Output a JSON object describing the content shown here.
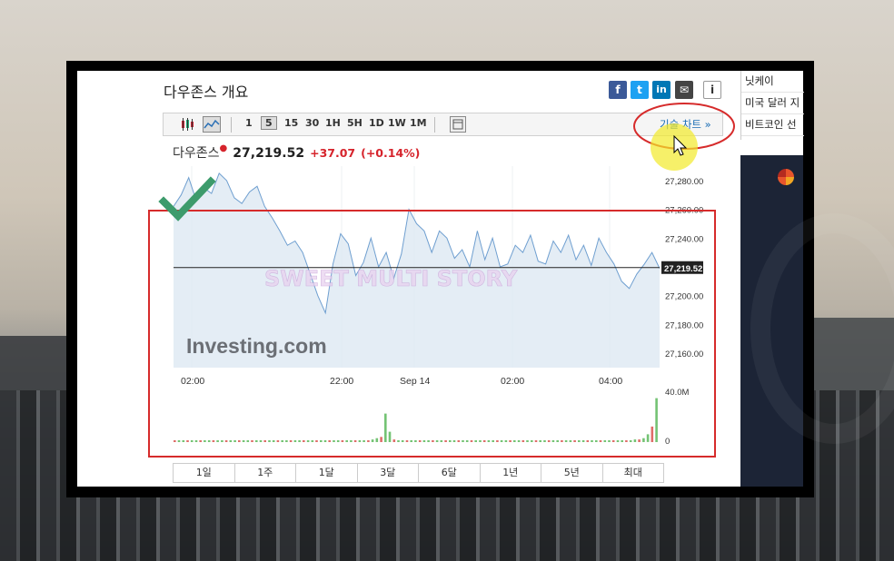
{
  "page": {
    "title": "다우존스 개요"
  },
  "share": {
    "facebook": "f",
    "twitter": "t",
    "linkedin": "in",
    "mail": "✉",
    "info": "i"
  },
  "toolbar": {
    "intervals": [
      "1",
      "5",
      "15",
      "30",
      "1H",
      "5H",
      "1D",
      "1W",
      "1M"
    ],
    "selected_interval": "5",
    "tech_chart_label": "기술 차트 »"
  },
  "quote": {
    "name": "다우존스",
    "price": "27,219.52",
    "change": "+37.07",
    "change_pct": "(+0.14%)"
  },
  "side_list": [
    "닛케이",
    "미국 달러 지",
    "비트코인 선"
  ],
  "periods": [
    "1일",
    "1주",
    "1달",
    "3달",
    "6달",
    "1년",
    "5년",
    "최대"
  ],
  "watermark": "Investing.com",
  "overlay_text": "SWEET MULTI STORY",
  "colors": {
    "accent": "#1b6eb5",
    "negative": "#d6242c",
    "area_fill": "#dde8f3",
    "area_line": "#6f9fd0",
    "annotation": "#d62b2b",
    "check": "#3d9b6c",
    "cursor_highlight": "#f2ea2a"
  },
  "chart_data": {
    "type": "area",
    "ylim": [
      27150,
      27290
    ],
    "y_ticks": [
      "27,280.00",
      "27,260.00",
      "27,240.00",
      "27,220.00",
      "27,200.00",
      "27,180.00",
      "27,160.00"
    ],
    "y_tick_values": [
      27280,
      27260,
      27240,
      27220,
      27200,
      27180,
      27160
    ],
    "x_ticks": [
      "02:00",
      "22:00",
      "Sep 14",
      "02:00",
      "04:00"
    ],
    "last_value_label": "27,219.52",
    "reference_line": 27219.52,
    "values": [
      27262,
      27270,
      27282,
      27266,
      27275,
      27271,
      27285,
      27280,
      27268,
      27264,
      27272,
      27276,
      27262,
      27254,
      27245,
      27235,
      27238,
      27230,
      27215,
      27200,
      27188,
      27222,
      27243,
      27236,
      27214,
      27223,
      27240,
      27220,
      27230,
      27212,
      27229,
      27260,
      27250,
      27245,
      27230,
      27245,
      27240,
      27226,
      27232,
      27220,
      27245,
      27225,
      27240,
      27220,
      27222,
      27235,
      27230,
      27242,
      27224,
      27222,
      27238,
      27230,
      27242,
      27225,
      27235,
      27221,
      27240,
      27230,
      27222,
      27210,
      27205,
      27215,
      27222,
      27230,
      27219
    ],
    "volume_label_max": "40.0M",
    "volume_label_min": "0",
    "volume_max": 40,
    "volume": [
      1,
      1,
      1,
      1,
      1,
      1,
      1,
      1,
      1,
      1,
      1,
      1,
      1,
      1,
      1,
      1,
      1,
      1,
      1,
      1,
      1,
      1,
      1,
      1,
      1,
      1,
      1,
      1,
      1,
      1,
      1,
      1,
      1,
      1,
      1,
      1,
      1,
      1,
      1,
      1,
      1,
      1,
      1,
      1,
      1,
      1,
      2,
      3,
      4,
      22,
      8,
      2,
      1,
      1,
      1,
      1,
      1,
      1,
      1,
      1,
      1,
      1,
      1,
      1,
      1,
      1,
      1,
      1,
      1,
      1,
      1,
      1,
      1,
      1,
      1,
      1,
      1,
      1,
      1,
      1,
      1,
      1,
      1,
      1,
      1,
      1,
      1,
      1,
      1,
      1,
      1,
      1,
      1,
      1,
      1,
      1,
      1,
      1,
      1,
      1,
      1,
      1,
      1,
      1,
      1,
      1,
      1,
      2,
      2,
      3,
      6,
      12,
      34
    ]
  }
}
